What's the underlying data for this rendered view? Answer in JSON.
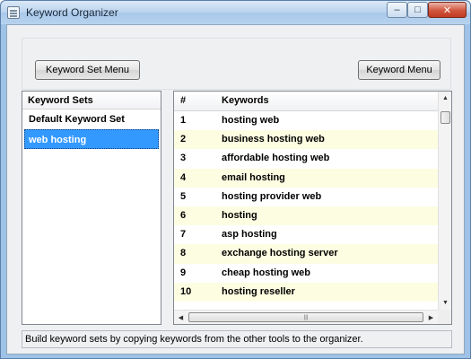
{
  "window": {
    "title": "Keyword Organizer",
    "controls": {
      "minimize": "–",
      "maximize": "□",
      "close": "✕"
    }
  },
  "toolbar": {
    "set_menu_label": "Keyword Set  Menu",
    "keyword_menu_label": "Keyword Menu"
  },
  "sets": {
    "header": "Keyword Sets",
    "items": [
      {
        "label": "Default Keyword Set",
        "selected": false
      },
      {
        "label": "web hosting",
        "selected": true
      }
    ]
  },
  "keywords": {
    "col_num": "#",
    "col_keyword": "Keywords",
    "rows": [
      {
        "num": "1",
        "keyword": "hosting web"
      },
      {
        "num": "2",
        "keyword": "business hosting web"
      },
      {
        "num": "3",
        "keyword": "affordable hosting web"
      },
      {
        "num": "4",
        "keyword": "email hosting"
      },
      {
        "num": "5",
        "keyword": "hosting provider web"
      },
      {
        "num": "6",
        "keyword": "hosting"
      },
      {
        "num": "7",
        "keyword": "asp hosting"
      },
      {
        "num": "8",
        "keyword": "exchange hosting server"
      },
      {
        "num": "9",
        "keyword": "cheap hosting web"
      },
      {
        "num": "10",
        "keyword": "hosting reseller"
      }
    ]
  },
  "status": {
    "text": "Build keyword sets by copying keywords from the other tools to the organizer."
  },
  "colors": {
    "selection": "#3399ff",
    "alt_row": "#fdfde2",
    "title_bar": "#b9d3ee"
  }
}
